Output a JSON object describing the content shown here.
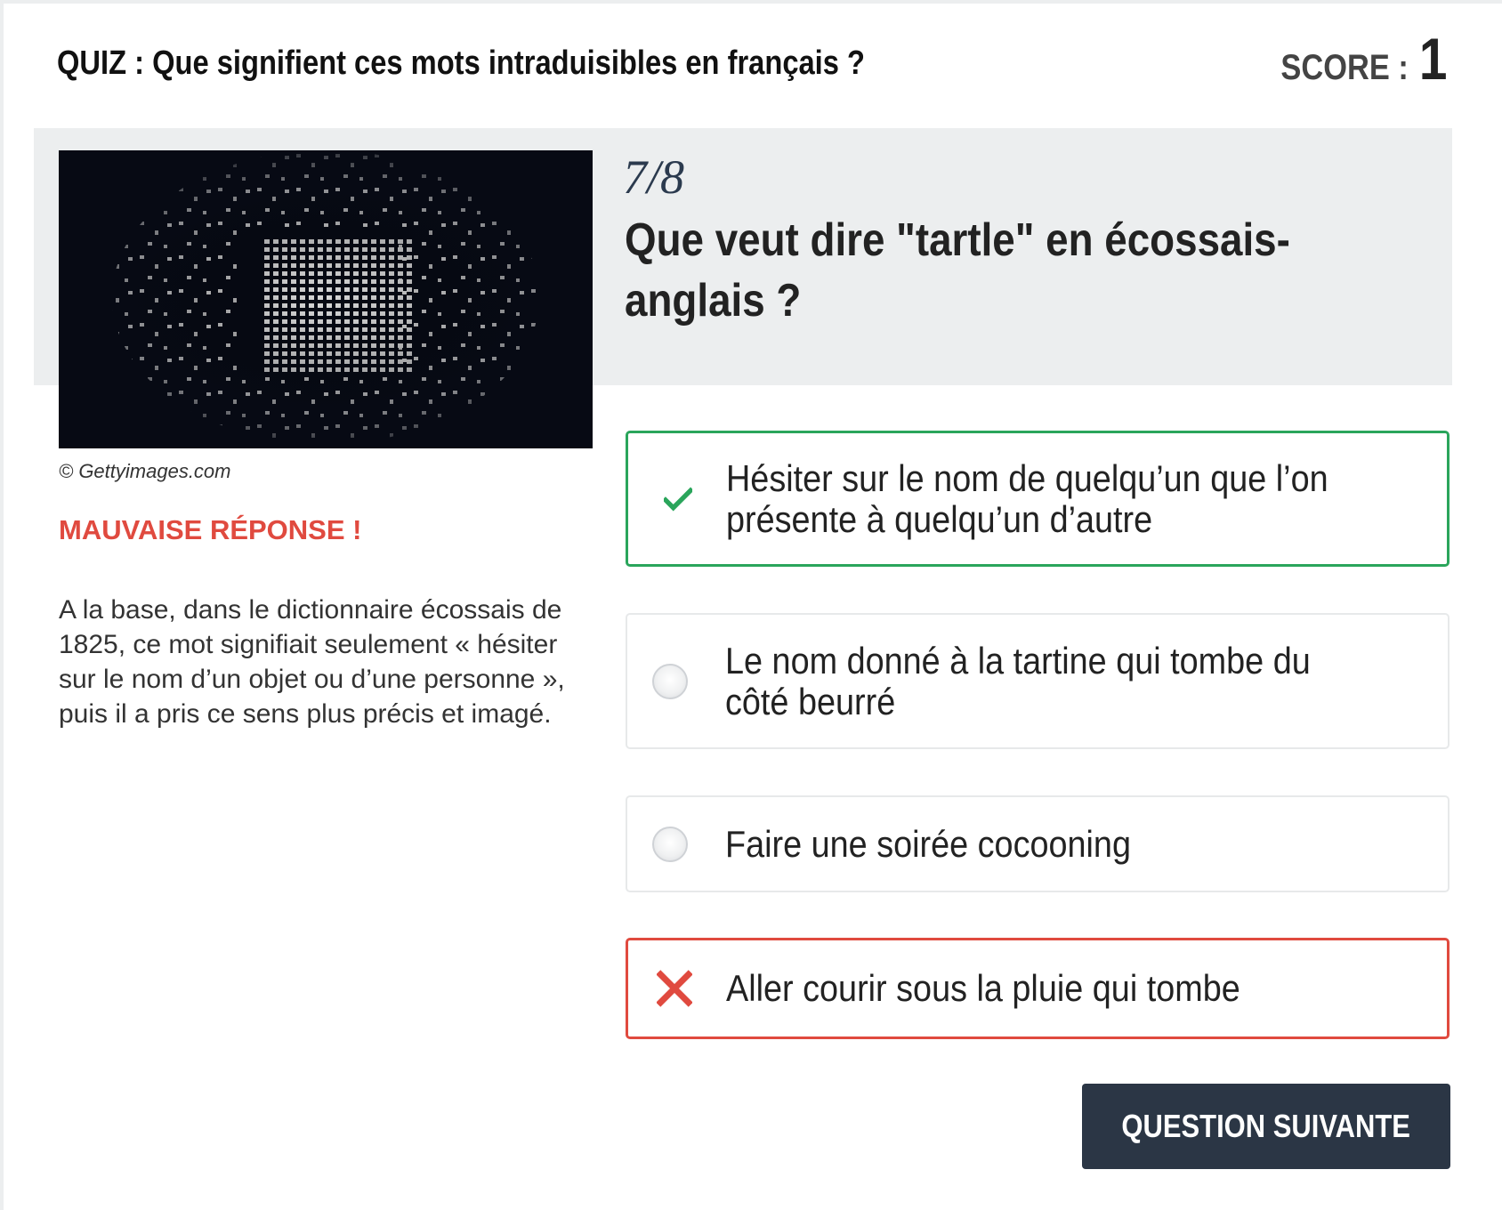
{
  "header": {
    "quiz_title": "QUIZ : Que signifient ces mots intraduisibles en français ?",
    "score_label": "SCORE :",
    "score_value": "1"
  },
  "question": {
    "counter": "7/8",
    "text": "Que veut dire \"tartle\" en écossais-anglais ?"
  },
  "media": {
    "image_alt": "Photo of scattered white letter tiles on black background",
    "credit": "© Gettyimages.com"
  },
  "feedback": {
    "verdict": "MAUVAISE RÉPONSE !",
    "explanation": "A la base, dans le dictionnaire écossais de 1825, ce mot signifiait seulement « hésiter sur le nom d’un objet ou d’une personne », puis il a pris ce sens plus précis et imagé."
  },
  "answers": [
    {
      "label": "Hésiter sur le nom de quelqu’un que l’on présente à quelqu’un d’autre",
      "state": "correct",
      "icon": "check-icon"
    },
    {
      "label": "Le nom donné à la tartine qui tombe du côté beurré",
      "state": "neutral",
      "icon": "radio-icon"
    },
    {
      "label": "Faire une soirée cocooning",
      "state": "neutral",
      "icon": "radio-icon"
    },
    {
      "label": "Aller courir sous la pluie qui tombe",
      "state": "wrong",
      "icon": "cross-icon"
    }
  ],
  "actions": {
    "next_label": "QUESTION SUIVANTE"
  },
  "colors": {
    "correct": "#2aa55b",
    "wrong": "#e04a3f",
    "band": "#eceeef",
    "button": "#2b3645"
  }
}
